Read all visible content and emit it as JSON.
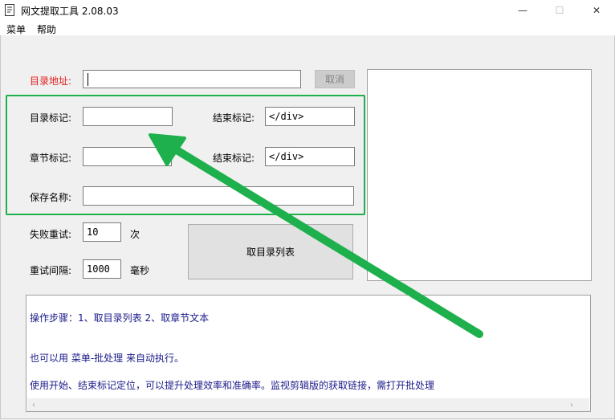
{
  "window": {
    "title": "网文提取工具  2.08.03",
    "minimize_glyph": "—",
    "maximize_glyph": "☐",
    "close_glyph": "✕"
  },
  "menu": {
    "items": [
      "菜单",
      "帮助"
    ]
  },
  "form": {
    "dir_address_label": "目录地址:",
    "dir_address_value": "",
    "cancel_label": "取消",
    "dir_mark_label": "目录标记:",
    "dir_mark_value": "",
    "end_mark_label_1": "结束标记:",
    "end_mark_value_1": "</div>",
    "chapter_mark_label": "章节标记:",
    "chapter_mark_value": "",
    "end_mark_label_2": "结束标记:",
    "end_mark_value_2": "</div>",
    "save_name_label": "保存名称:",
    "save_name_value": "",
    "retry_label": "失败重试:",
    "retry_value": "10",
    "retry_unit": "次",
    "interval_label": "重试间隔:",
    "interval_value": "1000",
    "interval_unit": "毫秒",
    "get_list_button": "取目录列表"
  },
  "log": {
    "lines": [
      "操作步骤：1、取目录列表          2、取章节文本",
      "也可以用 菜单-批处理 来自动执行。",
      "使用开始、结束标记定位，可以提升处理效率和准确率。监视剪辑版的获取链接，需打开批处理"
    ],
    "scroll_left": "‹",
    "scroll_right": "›"
  },
  "colors": {
    "highlight_box": "#1eb04c",
    "arrow": "#1eb04c",
    "required_label": "#e21b1b",
    "log_text": "#1a1a8a"
  },
  "icons": [
    "app-icon",
    "arrow-annotation-icon"
  ]
}
